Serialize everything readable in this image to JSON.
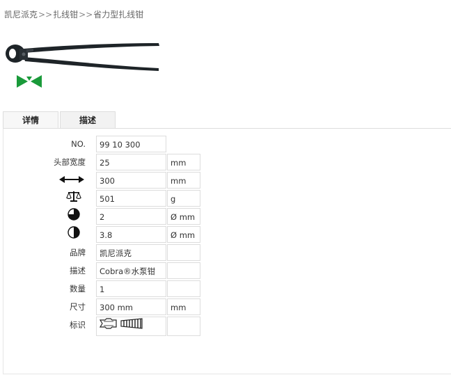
{
  "breadcrumb": {
    "items": [
      "凯尼派克",
      "扎线钳",
      "省力型扎线钳"
    ],
    "separator": ">>"
  },
  "tabs": [
    {
      "label": "详情",
      "active": true
    },
    {
      "label": "描述",
      "active": false
    }
  ],
  "specs": [
    {
      "label": "NO.",
      "value": "99 10 300",
      "unit": null
    },
    {
      "label": "头部宽度",
      "value": "25",
      "unit": "mm"
    },
    {
      "icon": "length-arrow-icon",
      "value": "300",
      "unit": "mm"
    },
    {
      "icon": "scale-weight-icon",
      "value": "501",
      "unit": "g"
    },
    {
      "icon": "three-quarter-circle-icon",
      "value": "2",
      "unit": "Ø mm"
    },
    {
      "icon": "half-circle-icon",
      "value": "3.8",
      "unit": "Ø mm"
    },
    {
      "label": "品牌",
      "value": "凯尼派克",
      "unit": ""
    },
    {
      "label": "描述",
      "value": "Cobra®水泵钳",
      "unit": ""
    },
    {
      "label": "数量",
      "value": "1",
      "unit": ""
    },
    {
      "label": "尺寸",
      "value": "300 mm",
      "unit": "mm"
    },
    {
      "label": "标识",
      "value_icons": [
        "mark-grip-icon",
        "mark-serration-icon"
      ],
      "unit": ""
    }
  ],
  "colors": {
    "logo_green": "#1a9a3a",
    "tool_dark": "#1e2428"
  }
}
